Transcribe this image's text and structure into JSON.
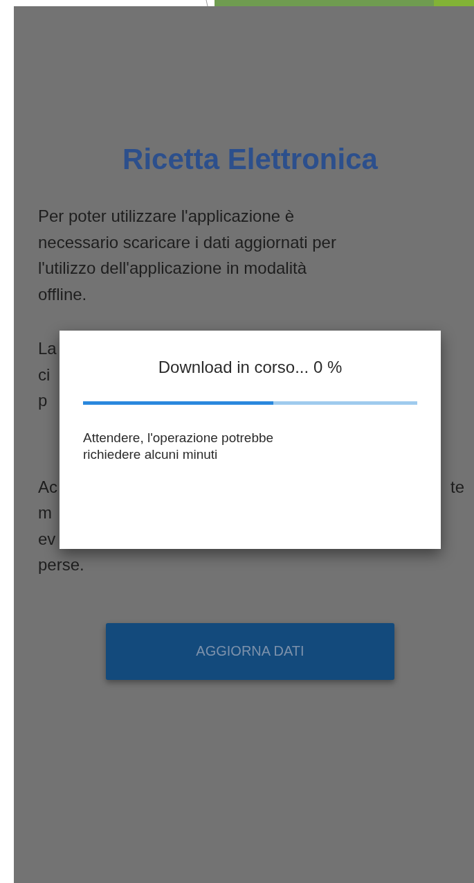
{
  "screen": {
    "title": "Ricetta Elettronica",
    "paragraphs": [
      {
        "lines": [
          {
            "left": "Per poter utilizzare l'applicazione è"
          },
          {
            "left": "necessario scaricare i dati aggiornati per"
          },
          {
            "left": "l'utilizzo dell'applicazione in modalità"
          },
          {
            "left": "offline."
          }
        ]
      },
      {
        "lines": [
          {
            "left": "La"
          },
          {
            "left": "ci"
          },
          {
            "left": "p"
          }
        ]
      },
      {
        "lines": [
          {
            "left": "Ac",
            "right": "te"
          },
          {
            "left": "m"
          },
          {
            "left": "ev"
          },
          {
            "left": "perse."
          }
        ]
      }
    ],
    "button": {
      "label": "AGGIORNA DATI"
    }
  },
  "dialog": {
    "title": "Download in corso... 0 %",
    "progress": {
      "level": 0.57
    },
    "message": "Attendere, l'operazione potrebbe richiedere alcuni minuti"
  }
}
